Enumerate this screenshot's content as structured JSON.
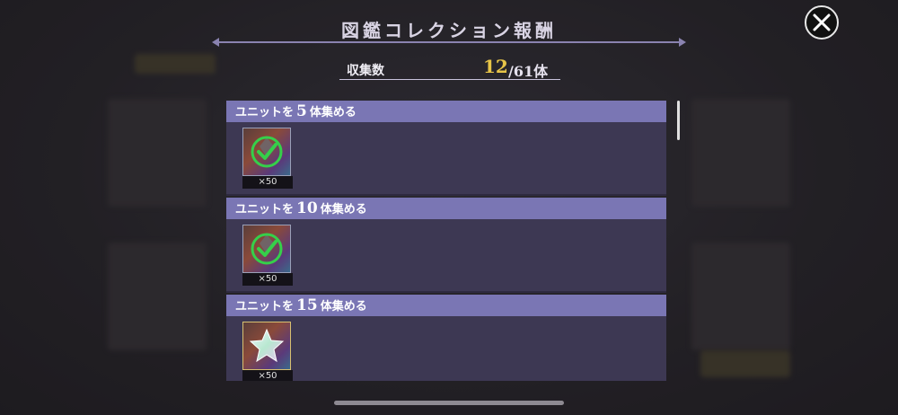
{
  "title": "図鑑コレクション報酬",
  "collection": {
    "label": "収集数",
    "current": "12",
    "total": "/61体"
  },
  "rewards": [
    {
      "prefix": "ユニットを",
      "count": "5",
      "suffix": "体集める",
      "item": {
        "quantity": "×50",
        "icon": "checkmark-icon",
        "claimed": true
      }
    },
    {
      "prefix": "ユニットを",
      "count": "10",
      "suffix": "体集める",
      "item": {
        "quantity": "×50",
        "icon": "checkmark-icon",
        "claimed": true
      }
    },
    {
      "prefix": "ユニットを",
      "count": "15",
      "suffix": "体集める",
      "item": {
        "quantity": "×50",
        "icon": "star-icon",
        "claimed": false
      }
    }
  ],
  "colors": {
    "header_bar": "#7a76b4",
    "body_bg": "#3d3853",
    "accent_count": "#e8c548",
    "check_green": "#35d04a"
  }
}
